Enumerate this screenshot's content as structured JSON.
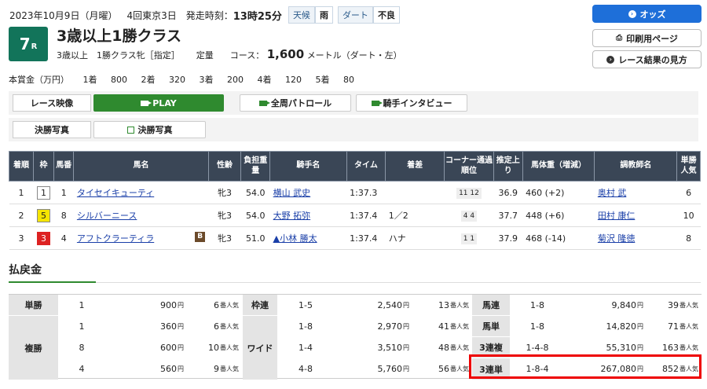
{
  "header": {
    "date": "2023年10月9日（月曜）",
    "meeting": "4回東京3日",
    "start_label": "発走時刻：",
    "start_time": "13時25分",
    "weather_label": "天候",
    "weather": "雨",
    "track_label": "ダート",
    "track_cond": "不良"
  },
  "race": {
    "number": "7",
    "number_suffix": "R",
    "title": "3歳以上1勝クラス",
    "conditions": "3歳以上　1勝クラス牝［指定］",
    "weight_rule": "定量",
    "course_label": "コース：",
    "distance": "1,600",
    "course_detail": "メートル（ダート・左）"
  },
  "prize": {
    "label": "本賞金（万円）",
    "items": [
      "1着",
      "800",
      "2着",
      "320",
      "3着",
      "200",
      "4着",
      "120",
      "5着",
      "80"
    ]
  },
  "right_buttons": {
    "odds": "オッズ",
    "print": "印刷用ページ",
    "guide": "レース結果の見方"
  },
  "media": {
    "video_label": "レース映像",
    "play": "PLAY",
    "patrol": "全周パトロール",
    "interview": "騎手インタビュー",
    "photo_label": "決勝写真",
    "photo_btn": "決勝写真"
  },
  "results": {
    "headers": [
      "着順",
      "枠",
      "馬番",
      "馬名",
      "性齢",
      "負担重量",
      "騎手名",
      "タイム",
      "着差",
      "コーナー通過順位",
      "推定上り",
      "馬体重（増減）",
      "調教師名",
      "単勝人気"
    ],
    "rows": [
      {
        "rank": "1",
        "waku": "1",
        "num": "1",
        "horse": "タイセイキューティ",
        "blink": "",
        "sex": "牝3",
        "weight": "54.0",
        "jockey": "横山 武史",
        "time": "1:37.3",
        "margin": "",
        "corner": "11 12",
        "agari": "36.9",
        "body": "460 (+2)",
        "trainer": "奥村 武",
        "pop": "6"
      },
      {
        "rank": "2",
        "waku": "5",
        "num": "8",
        "horse": "シルバーニース",
        "blink": "",
        "sex": "牝3",
        "weight": "54.0",
        "jockey": "大野 拓弥",
        "time": "1:37.4",
        "margin": "1／2",
        "corner": "4 4",
        "agari": "37.7",
        "body": "448 (+6)",
        "trainer": "田村 康仁",
        "pop": "10"
      },
      {
        "rank": "3",
        "waku": "3",
        "num": "4",
        "horse": "アフトクラーティラ",
        "blink": "B",
        "sex": "牝3",
        "weight": "51.0",
        "jockey": "▲小林 勝太",
        "time": "1:37.4",
        "margin": "ハナ",
        "corner": "1 1",
        "agari": "37.9",
        "body": "468 (-14)",
        "trainer": "菊沢 隆徳",
        "pop": "8"
      }
    ]
  },
  "payout": {
    "title": "払戻金",
    "yen": "円",
    "ninki": "番人気",
    "tansho": {
      "label": "単勝",
      "num": "1",
      "amount": "900",
      "pop": "6"
    },
    "fukusho": {
      "label": "複勝",
      "rows": [
        {
          "num": "1",
          "amount": "360",
          "pop": "6"
        },
        {
          "num": "8",
          "amount": "600",
          "pop": "10"
        },
        {
          "num": "4",
          "amount": "560",
          "pop": "9"
        }
      ]
    },
    "wakuren": {
      "label": "枠連",
      "num": "1-5",
      "amount": "2,540",
      "pop": "13"
    },
    "wide": {
      "label": "ワイド",
      "rows": [
        {
          "num": "1-8",
          "amount": "2,970",
          "pop": "41"
        },
        {
          "num": "1-4",
          "amount": "3,510",
          "pop": "48"
        },
        {
          "num": "4-8",
          "amount": "5,760",
          "pop": "56"
        }
      ]
    },
    "right": [
      {
        "label": "馬連",
        "num": "1-8",
        "amount": "9,840",
        "pop": "39"
      },
      {
        "label": "馬単",
        "num": "1-8",
        "amount": "14,820",
        "pop": "71"
      },
      {
        "label": "3連複",
        "num": "1-4-8",
        "amount": "55,310",
        "pop": "163"
      },
      {
        "label": "3連単",
        "num": "1-8-4",
        "amount": "267,080",
        "pop": "852"
      }
    ]
  }
}
